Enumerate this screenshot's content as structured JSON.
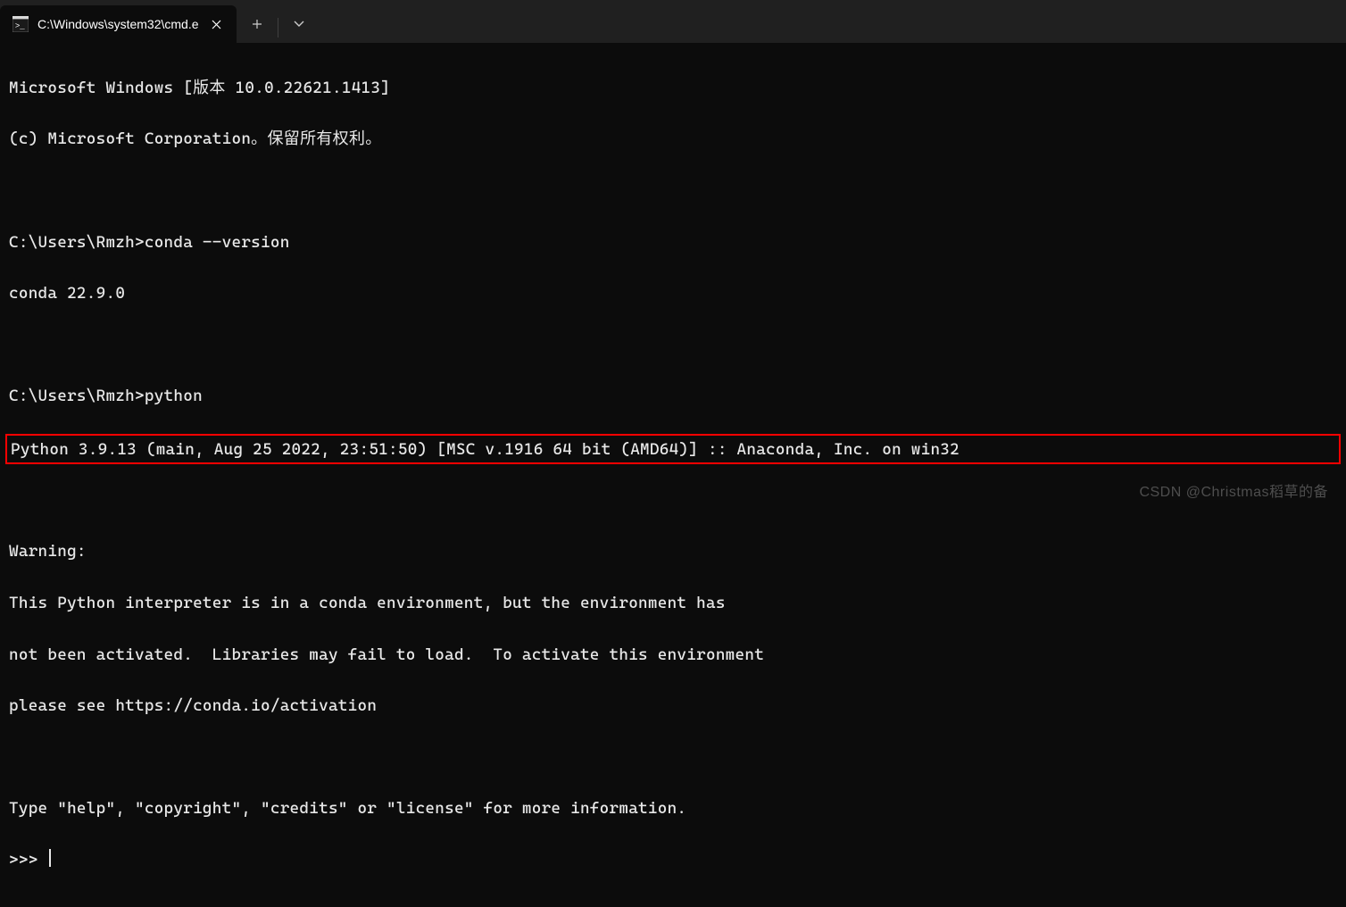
{
  "titlebar": {
    "tab_title": "C:\\Windows\\system32\\cmd.e"
  },
  "terminal": {
    "lines": [
      "Microsoft Windows [版本 10.0.22621.1413]",
      "(c) Microsoft Corporation。保留所有权利。",
      "",
      "C:\\Users\\Rmzh>conda --version",
      "conda 22.9.0",
      "",
      "C:\\Users\\Rmzh>python"
    ],
    "highlighted": "Python 3.9.13 (main, Aug 25 2022, 23:51:50) [MSC v.1916 64 bit (AMD64)] :: Anaconda, Inc. on win32",
    "lines2": [
      "",
      "Warning:",
      "This Python interpreter is in a conda environment, but the environment has",
      "not been activated.  Libraries may fail to load.  To activate this environment",
      "please see https://conda.io/activation",
      "",
      "Type \"help\", \"copyright\", \"credits\" or \"license\" for more information."
    ],
    "prompt": ">>> "
  },
  "watermark": "CSDN @Christmas稻草的备"
}
